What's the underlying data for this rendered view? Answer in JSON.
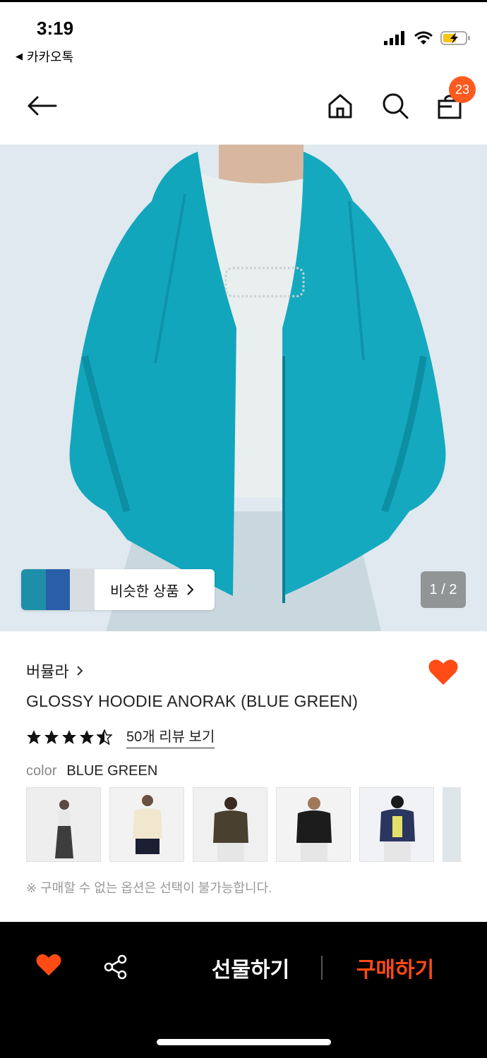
{
  "status_bar": {
    "time": "3:19",
    "back_app": "카카오톡",
    "icons": [
      "signal-icon",
      "wifi-icon",
      "battery-charging-icon"
    ]
  },
  "nav": {
    "icons": [
      "back-arrow-icon",
      "home-icon",
      "search-icon",
      "cart-icon"
    ],
    "cart_count": "23"
  },
  "hero": {
    "similar_label": "비슷한 상품",
    "page_indicator": "1 / 2",
    "colors": {
      "jacket": "#12a6bd",
      "shirt": "#e9efee",
      "background": "#dfe9ef"
    }
  },
  "product": {
    "brand": "버뮬라",
    "title": "GLOSSY HOODIE ANORAK (BLUE GREEN)",
    "rating": 4.5,
    "review_link": "50개 리뷰 보기",
    "color_label": "color",
    "color_value": "BLUE GREEN",
    "swatch_colors": [
      "#3d3d3d",
      "#f1e7cf",
      "#4a4030",
      "#1c1c1c",
      "#2a3560",
      "#dfe6ea"
    ],
    "notice": "※ 구매할 수 없는 옵션은 선택이 불가능합니다."
  },
  "bottom_bar": {
    "gift_label": "선물하기",
    "buy_label": "구매하기",
    "accent": "#ff4b14"
  }
}
